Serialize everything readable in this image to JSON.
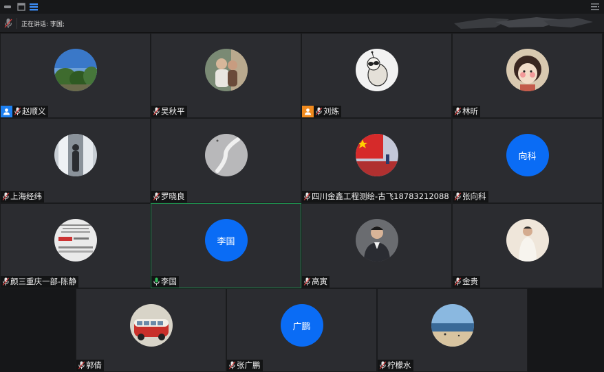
{
  "status": {
    "label": "正在讲话: 李国;"
  },
  "participants": [
    {
      "name": "赵顺义",
      "role": "host",
      "avatar": "photo-trees-sky"
    },
    {
      "name": "吴秋平",
      "role": "",
      "avatar": "photo-couple"
    },
    {
      "name": "刘炼",
      "role": "cohost",
      "avatar": "photo-cartoon-dog"
    },
    {
      "name": "林昕",
      "role": "",
      "avatar": "photo-cartoon-girl"
    },
    {
      "name": "上海经纬",
      "role": "",
      "avatar": "photo-silhouette-window"
    },
    {
      "name": "罗晓良",
      "role": "",
      "avatar": "photo-grey-curve"
    },
    {
      "name": "四川金鑫工程测绘-古飞18783212088",
      "role": "",
      "avatar": "photo-flag"
    },
    {
      "name": "张向科",
      "role": "",
      "initials": "向科"
    },
    {
      "name": "颜三重庆一部-陈静",
      "role": "",
      "avatar": "photo-document-slide"
    },
    {
      "name": "李国",
      "role": "",
      "initials": "李国",
      "speaking": true
    },
    {
      "name": "高寅",
      "role": "",
      "avatar": "photo-man-suit"
    },
    {
      "name": "金贵",
      "role": "",
      "avatar": "photo-man-white"
    },
    {
      "name": "郭倩",
      "role": "",
      "avatar": "photo-red-van"
    },
    {
      "name": "张广鹏",
      "role": "",
      "initials": "广鹏"
    },
    {
      "name": "柠檬水",
      "role": "",
      "avatar": "photo-beach"
    }
  ],
  "colors": {
    "accent": "#0a6cf5",
    "speaking_border": "#1f8a4c",
    "tile_bg": "#2b2c30",
    "host_badge": "#1e80f0",
    "cohost_badge": "#f08a1e",
    "mic_muted": "#d23a3a",
    "mic_active": "#2fbf5a"
  }
}
